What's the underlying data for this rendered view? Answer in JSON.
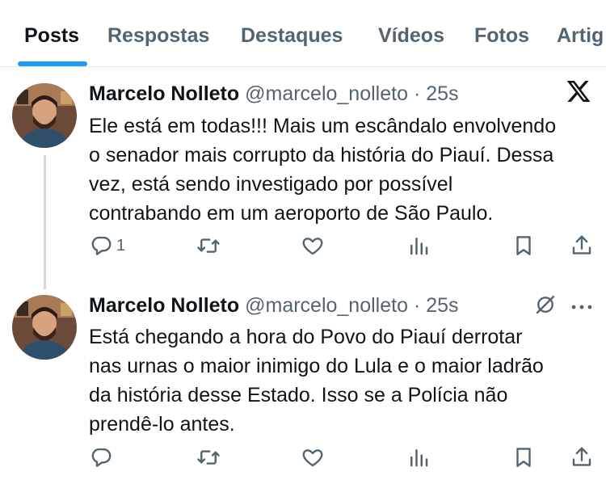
{
  "tabs": [
    "Posts",
    "Respostas",
    "Destaques",
    "Vídeos",
    "Fotos",
    "Artig"
  ],
  "active_tab": "Posts",
  "accent_color": "#1d9bf0",
  "posts": [
    {
      "name": "Marcelo Nolleto",
      "handle": "@marcelo_nolleto",
      "separator": "·",
      "time": "25s",
      "text_lines": [
        "Ele está em todas!!! Mais um escândalo envolvendo",
        "o senador mais corrupto da história do Piauí. Dessa",
        "vez, está sendo investigado por possível",
        "contrabando em um aeroporto de São Paulo."
      ],
      "corner_icon": "x-logo-icon",
      "actions": {
        "reply_count": "1",
        "icons": [
          "reply-icon",
          "repost-icon",
          "like-icon",
          "views-icon",
          "bookmark-icon",
          "share-icon"
        ]
      }
    },
    {
      "name": "Marcelo Nolleto",
      "handle": "@marcelo_nolleto",
      "separator": "·",
      "time": "25s",
      "text_lines": [
        "Está chegando a hora do Povo do Piauí derrotar",
        "nas urnas o maior inimigo do Lula e o maior ladrão",
        "da história desse Estado. Isso se a Polícia não",
        "prendê-lo antes."
      ],
      "corner_icons": [
        "grok-icon",
        "more-icon"
      ],
      "actions": {
        "icons": [
          "reply-icon",
          "repost-icon",
          "like-icon",
          "views-icon",
          "bookmark-icon",
          "share-icon"
        ]
      }
    }
  ]
}
